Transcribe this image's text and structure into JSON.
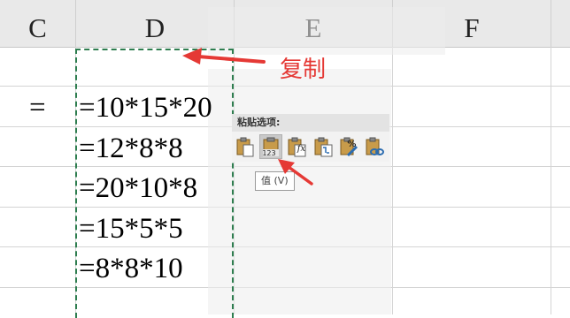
{
  "columns": {
    "c": "C",
    "d": "D",
    "e": "E",
    "f": "F"
  },
  "cells": {
    "c_equals": "=",
    "d": [
      "=10*15*20",
      "=12*8*8",
      "=20*10*8",
      "=15*5*5",
      "=8*8*10"
    ]
  },
  "annotation": {
    "copy_label": "复制"
  },
  "paste_menu": {
    "title": "粘贴选项:",
    "value_tooltip": "值 (V)",
    "value_icon_badge": "123",
    "formula_icon_badge": "fx",
    "format_icon_badge": "%",
    "icons": [
      "paste-icon",
      "paste-values-icon",
      "paste-formulas-icon",
      "paste-transpose-icon",
      "paste-formatting-icon",
      "paste-link-icon"
    ]
  },
  "colors": {
    "annotation_red": "#e53935",
    "marquee_green": "#2e7d4f",
    "header_bg": "#e9e9e9"
  }
}
